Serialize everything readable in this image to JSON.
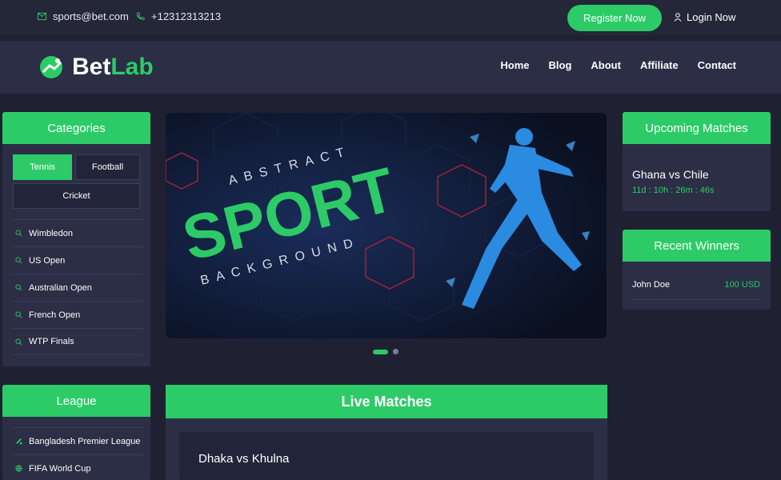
{
  "topbar": {
    "email": "sports@bet.com",
    "phone": "+12312313213",
    "register_label": "Register Now",
    "login_label": "Login Now"
  },
  "brand": {
    "part1": "Bet",
    "part2": "Lab"
  },
  "nav": {
    "items": [
      "Home",
      "Blog",
      "About",
      "Affiliate",
      "Contact"
    ]
  },
  "categories": {
    "title": "Categories",
    "chips": [
      "Tennis",
      "Football",
      "Cricket"
    ],
    "active_chip": "Tennis",
    "items": [
      "Wimbledon",
      "US Open",
      "Australian Open",
      "French Open",
      "WTP Finals"
    ]
  },
  "banner": {
    "top_text": "ABSTRACT",
    "main_text": "SPORT",
    "bottom_text": "BACKGROUND"
  },
  "upcoming": {
    "title": "Upcoming Matches",
    "match": "Ghana vs Chile",
    "countdown": "11d : 10h : 26m : 46s"
  },
  "winners": {
    "title": "Recent Winners",
    "rows": [
      {
        "name": "John Doe",
        "amount": "100 USD"
      }
    ]
  },
  "league": {
    "title": "League",
    "items": [
      "Bangladesh Premier League",
      "FIFA World Cup"
    ]
  },
  "live": {
    "title": "Live Matches",
    "match": "Dhaka vs Khulna"
  },
  "colors": {
    "accent": "#2ccb67",
    "panel": "#2b2e45",
    "background": "#1f2133"
  }
}
